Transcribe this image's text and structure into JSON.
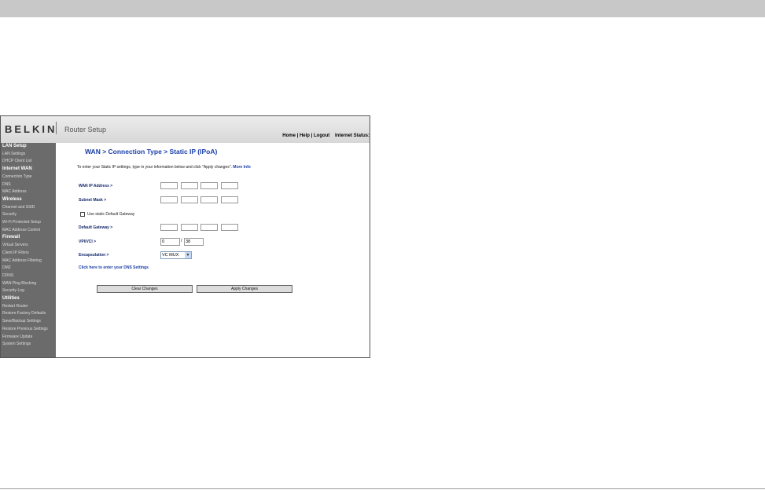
{
  "header": {
    "logo": "BELKIN",
    "app_title": "Router Setup",
    "links": [
      "Home",
      "Help",
      "Logout"
    ],
    "status_label": "Internet Status:"
  },
  "sidebar": [
    {
      "label": "LAN Setup",
      "section": true
    },
    {
      "label": "LAN Settings",
      "section": false
    },
    {
      "label": "DHCP Client List",
      "section": false
    },
    {
      "label": "Internet WAN",
      "section": true
    },
    {
      "label": "Connection Type",
      "section": false
    },
    {
      "label": "DNS",
      "section": false
    },
    {
      "label": "MAC Address",
      "section": false
    },
    {
      "label": "Wireless",
      "section": true
    },
    {
      "label": "Channel and SSID",
      "section": false
    },
    {
      "label": "Security",
      "section": false
    },
    {
      "label": "Wi-Fi Protected Setup",
      "section": false
    },
    {
      "label": "MAC Address Control",
      "section": false
    },
    {
      "label": "Firewall",
      "section": true
    },
    {
      "label": "Virtual Servers",
      "section": false
    },
    {
      "label": "Client IP Filters",
      "section": false
    },
    {
      "label": "MAC Address Filtering",
      "section": false
    },
    {
      "label": "DMZ",
      "section": false
    },
    {
      "label": "DDNS",
      "section": false
    },
    {
      "label": "WAN Ping Blocking",
      "section": false
    },
    {
      "label": "Security Log",
      "section": false
    },
    {
      "label": "Utilities",
      "section": true
    },
    {
      "label": "Restart Router",
      "section": false
    },
    {
      "label": "Restore Factory Defaults",
      "section": false
    },
    {
      "label": "Save/Backup Settings",
      "section": false
    },
    {
      "label": "Restore Previous Settings",
      "section": false
    },
    {
      "label": "Firmware Update",
      "section": false
    },
    {
      "label": "System Settings",
      "section": false
    }
  ],
  "main": {
    "title": "WAN > Connection Type > Static IP (IPoA)",
    "intro": "To enter your Static IP settings, type in your information below and click \"Apply changes\".",
    "more_info": "More Info",
    "wan_ip_label": "WAN IP Address >",
    "subnet_label": "Subnet Mask >",
    "use_gateway_label": "Use static Default Gateway",
    "gateway_label": "Default Gateway >",
    "vpivci_label": "VPI/VCI >",
    "vpi_value": "0",
    "slash": "/",
    "vci_value": "38",
    "encap_label": "Encapsulation >",
    "encap_value": "VC MUX",
    "dns_link": "Click here to enter your DNS Settings",
    "clear_button": "Clear Changes",
    "apply_button": "Apply Changes"
  }
}
